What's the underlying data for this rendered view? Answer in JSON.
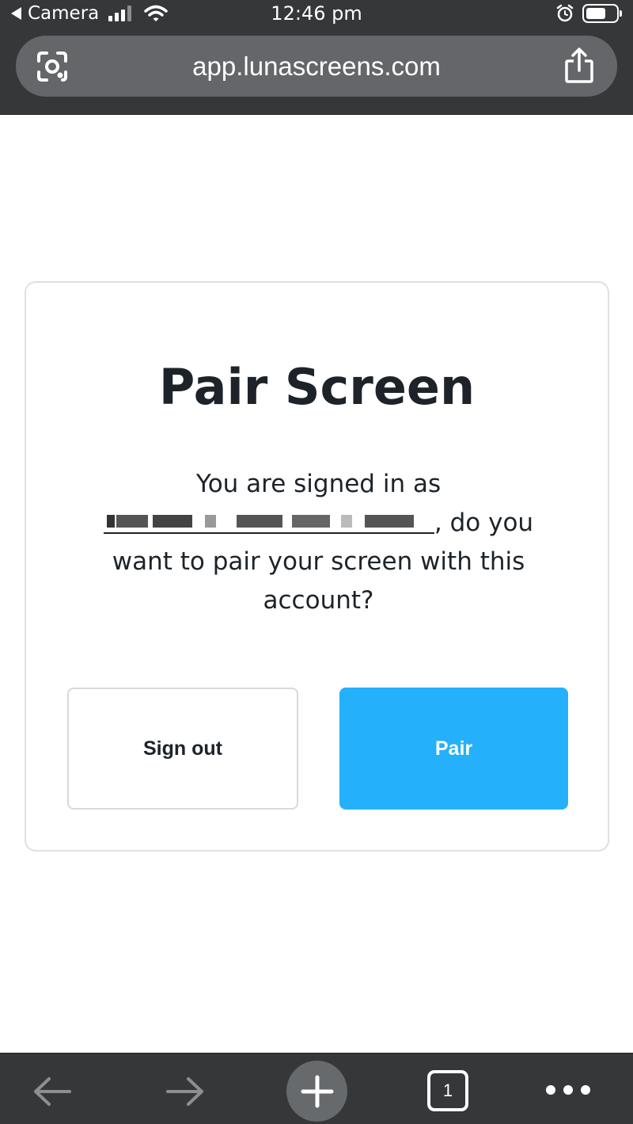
{
  "status_bar": {
    "back_app": "Camera",
    "time": "12:46 pm"
  },
  "browser": {
    "url": "app.lunascreens.com",
    "tab_count": "1"
  },
  "card": {
    "title": "Pair Screen",
    "message_prefix": "You are signed in as",
    "message_suffix": ", do you want to pair your screen with this account?",
    "sign_out_label": "Sign out",
    "pair_label": "Pair"
  },
  "colors": {
    "pair_button": "#25b0fb",
    "chrome_background": "#353739",
    "url_bar": "#646669"
  },
  "icons": {
    "top": [
      "back-triangle-icon",
      "cellular-signal-icon",
      "wifi-icon",
      "alarm-icon",
      "battery-icon",
      "google-lens-icon",
      "share-icon"
    ],
    "toolbar": [
      "back-arrow-icon",
      "forward-arrow-icon",
      "plus-icon",
      "tabs-icon",
      "more-icon"
    ]
  }
}
